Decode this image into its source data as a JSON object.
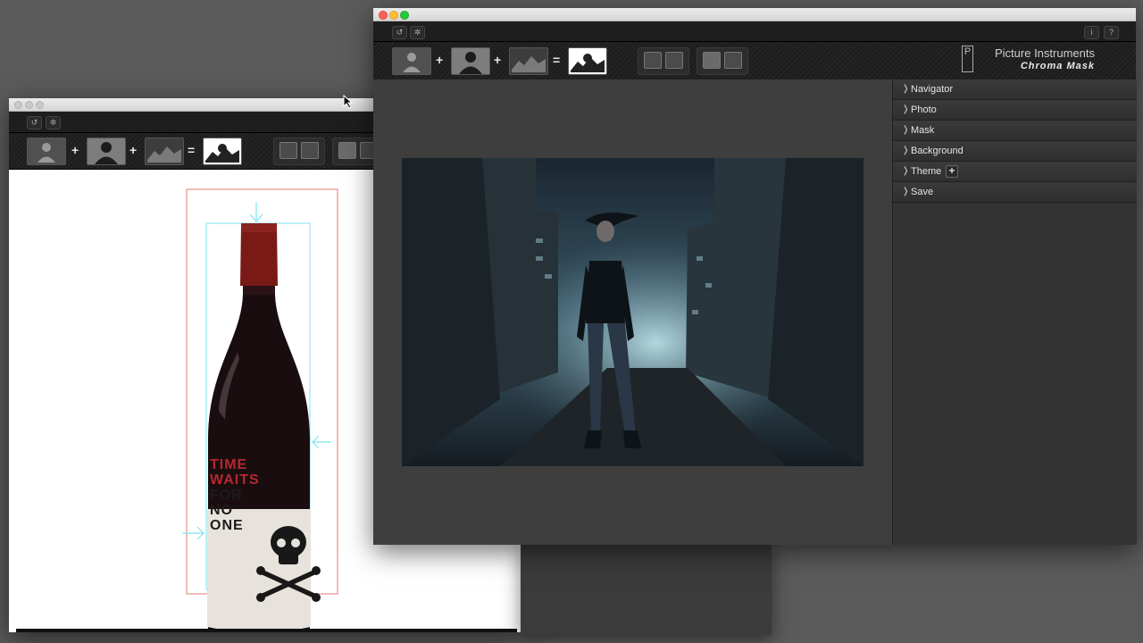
{
  "main_window": {
    "brand": {
      "name": "Picture Instruments",
      "product": "Chroma Mask",
      "logo_glyph": "P"
    },
    "info_button": "i",
    "help_button": "?",
    "operators": [
      "+",
      "+",
      "="
    ],
    "panel_items": [
      {
        "label": "Navigator",
        "icon": "chevron-right-icon"
      },
      {
        "label": "Photo",
        "icon": "chevron-right-icon"
      },
      {
        "label": "Mask",
        "icon": "chevron-right-icon"
      },
      {
        "label": "Background",
        "icon": "chevron-right-icon"
      },
      {
        "label": "Theme",
        "icon": "chevron-right-icon",
        "has_add": true
      },
      {
        "label": "Save",
        "icon": "chevron-right-icon"
      }
    ],
    "theme_add": "+"
  },
  "secondary_window": {
    "operators": [
      "+",
      "+",
      "="
    ],
    "bottle_label": {
      "lines": [
        "TIME",
        "WAITS",
        "FOR",
        "NO",
        "ONE"
      ],
      "red_lines": 2,
      "red": "#b3282d",
      "dark": "#1b1b1b"
    }
  },
  "toolbar_icons": [
    "reset-icon",
    "gear-icon",
    "person-icon",
    "silhouette-icon",
    "landscape-icon",
    "result-icon",
    "image-load-icon",
    "save-icon",
    "folder-icon"
  ],
  "colors": {
    "accent_cyan": "#7ee3f0",
    "crop_red": "#e07b74"
  }
}
